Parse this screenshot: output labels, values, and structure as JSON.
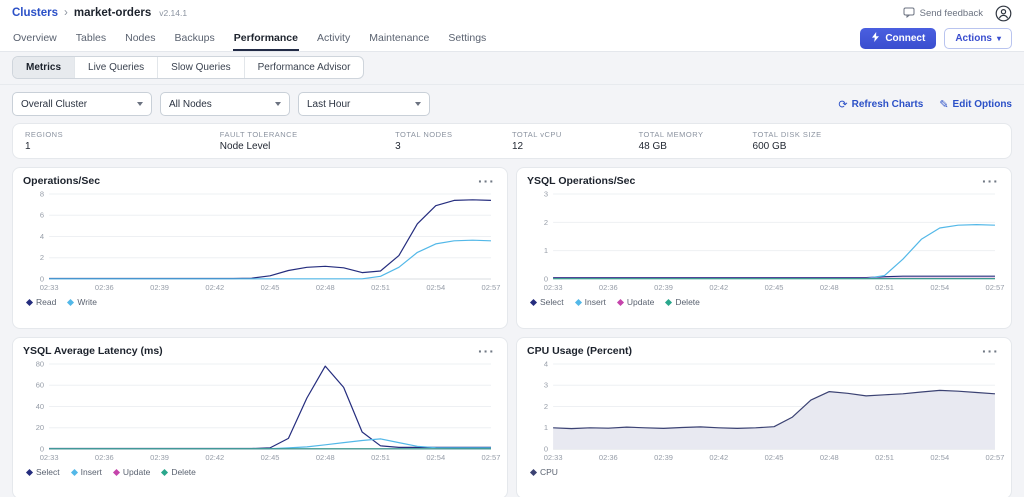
{
  "header": {
    "breadcrumb_root": "Clusters",
    "separator": "›",
    "cluster_name": "market-orders",
    "version": "v2.14.1",
    "send_feedback": "Send feedback"
  },
  "tabs": {
    "items": [
      "Overview",
      "Tables",
      "Nodes",
      "Backups",
      "Performance",
      "Activity",
      "Maintenance",
      "Settings"
    ],
    "active": "Performance",
    "connect_label": "Connect",
    "actions_label": "Actions"
  },
  "subtabs": {
    "items": [
      "Metrics",
      "Live Queries",
      "Slow Queries",
      "Performance Advisor"
    ],
    "active": "Metrics"
  },
  "filters": {
    "cluster_select": "Overall Cluster",
    "nodes_select": "All Nodes",
    "time_select": "Last Hour",
    "refresh_label": "Refresh Charts",
    "edit_label": "Edit Options"
  },
  "stats": {
    "items": [
      {
        "label": "REGIONS",
        "value": "1"
      },
      {
        "label": "FAULT TOLERANCE",
        "value": "Node Level"
      },
      {
        "label": "TOTAL NODES",
        "value": "3"
      },
      {
        "label": "TOTAL vCPU",
        "value": "12"
      },
      {
        "label": "TOTAL MEMORY",
        "value": "48 GB"
      },
      {
        "label": "TOTAL DISK SIZE",
        "value": "600 GB"
      }
    ]
  },
  "icons": {
    "refresh_glyph": "⟳",
    "edit_glyph": "✎",
    "caret_glyph": "▾"
  },
  "colors": {
    "accent_blue": "#2b50c7",
    "navy_series": "#252d7e",
    "light_blue_series": "#53b8e8",
    "magenta_series": "#c544ab",
    "teal_series": "#2aa78c",
    "cpu_line": "#3b4273",
    "cpu_fill": "#e8e9f1"
  },
  "chart_data": [
    {
      "type": "line",
      "title": "Operations/Sec",
      "ylim": [
        0,
        8
      ],
      "yticks": [
        0,
        2,
        4,
        6,
        8
      ],
      "x_labels": [
        "02:33",
        "02:36",
        "02:39",
        "02:42",
        "02:45",
        "02:48",
        "02:51",
        "02:54",
        "02:57"
      ],
      "x_label_step": 3,
      "series": [
        {
          "name": "Read",
          "color": "#252d7e",
          "values": [
            0.05,
            0.05,
            0.05,
            0.05,
            0.05,
            0.05,
            0.05,
            0.05,
            0.05,
            0.05,
            0.05,
            0.08,
            0.3,
            0.8,
            1.1,
            1.2,
            1.05,
            0.6,
            0.75,
            2.2,
            5.2,
            6.9,
            7.4,
            7.45,
            7.4
          ]
        },
        {
          "name": "Write",
          "color": "#53b8e8",
          "values": [
            0.02,
            0.02,
            0.02,
            0.02,
            0.02,
            0.02,
            0.02,
            0.02,
            0.02,
            0.02,
            0.02,
            0.02,
            0.02,
            0.02,
            0.02,
            0.02,
            0.02,
            0.02,
            0.25,
            1.1,
            2.5,
            3.3,
            3.6,
            3.65,
            3.6
          ]
        }
      ]
    },
    {
      "type": "line",
      "title": "YSQL Operations/Sec",
      "ylim": [
        0,
        3
      ],
      "yticks": [
        0,
        1,
        2,
        3
      ],
      "x_labels": [
        "02:33",
        "02:36",
        "02:39",
        "02:42",
        "02:45",
        "02:48",
        "02:51",
        "02:54",
        "02:57"
      ],
      "x_label_step": 3,
      "series": [
        {
          "name": "Select",
          "color": "#252d7e",
          "values": [
            0.05,
            0.05,
            0.05,
            0.05,
            0.05,
            0.05,
            0.05,
            0.05,
            0.05,
            0.05,
            0.05,
            0.05,
            0.05,
            0.05,
            0.05,
            0.05,
            0.05,
            0.05,
            0.08,
            0.1,
            0.1,
            0.1,
            0.1,
            0.1,
            0.1
          ]
        },
        {
          "name": "Insert",
          "color": "#53b8e8",
          "values": [
            0.02,
            0.02,
            0.02,
            0.02,
            0.02,
            0.02,
            0.02,
            0.02,
            0.02,
            0.02,
            0.02,
            0.02,
            0.02,
            0.02,
            0.02,
            0.02,
            0.02,
            0.02,
            0.12,
            0.7,
            1.4,
            1.8,
            1.9,
            1.92,
            1.9
          ]
        },
        {
          "name": "Update",
          "color": "#c544ab",
          "values": [
            0.02,
            0.02,
            0.02,
            0.02,
            0.02,
            0.02,
            0.02,
            0.02,
            0.02,
            0.02,
            0.02,
            0.02,
            0.02,
            0.02,
            0.02,
            0.02,
            0.02,
            0.02,
            0.02,
            0.02,
            0.02,
            0.02,
            0.02,
            0.02,
            0.02
          ]
        },
        {
          "name": "Delete",
          "color": "#2aa78c",
          "values": [
            0.01,
            0.01,
            0.01,
            0.01,
            0.01,
            0.01,
            0.01,
            0.01,
            0.01,
            0.01,
            0.01,
            0.01,
            0.01,
            0.01,
            0.01,
            0.01,
            0.01,
            0.01,
            0.01,
            0.01,
            0.01,
            0.01,
            0.01,
            0.01,
            0.01
          ]
        }
      ]
    },
    {
      "type": "line",
      "title": "YSQL Average Latency (ms)",
      "ylim": [
        0,
        80
      ],
      "yticks": [
        0,
        20,
        40,
        60,
        80
      ],
      "x_labels": [
        "02:33",
        "02:36",
        "02:39",
        "02:42",
        "02:45",
        "02:48",
        "02:51",
        "02:54",
        "02:57"
      ],
      "x_label_step": 3,
      "series": [
        {
          "name": "Select",
          "color": "#252d7e",
          "values": [
            0.5,
            0.5,
            0.5,
            0.5,
            0.5,
            0.5,
            0.5,
            0.5,
            0.5,
            0.5,
            0.5,
            0.5,
            1,
            10,
            48,
            78,
            58,
            16,
            3,
            1.5,
            1.5,
            1.5,
            1.5,
            1.5,
            1.5
          ]
        },
        {
          "name": "Insert",
          "color": "#53b8e8",
          "values": [
            0.3,
            0.3,
            0.3,
            0.3,
            0.3,
            0.3,
            0.3,
            0.3,
            0.3,
            0.3,
            0.3,
            0.3,
            0.3,
            1,
            2,
            4,
            6,
            8,
            9.5,
            6,
            2.5,
            1.2,
            1,
            1,
            1
          ]
        },
        {
          "name": "Update",
          "color": "#c544ab",
          "values": [
            0.2,
            0.2,
            0.2,
            0.2,
            0.2,
            0.2,
            0.2,
            0.2,
            0.2,
            0.2,
            0.2,
            0.2,
            0.2,
            0.2,
            0.2,
            0.2,
            0.2,
            0.2,
            0.2,
            0.2,
            0.2,
            0.2,
            0.2,
            0.2,
            0.2
          ]
        },
        {
          "name": "Delete",
          "color": "#2aa78c",
          "values": [
            0.15,
            0.15,
            0.15,
            0.15,
            0.15,
            0.15,
            0.15,
            0.15,
            0.15,
            0.15,
            0.15,
            0.15,
            0.15,
            0.15,
            0.15,
            0.15,
            0.15,
            0.15,
            0.15,
            0.15,
            0.15,
            0.15,
            0.15,
            0.15,
            0.15
          ]
        }
      ]
    },
    {
      "type": "area",
      "title": "CPU Usage (Percent)",
      "ylim": [
        0,
        4
      ],
      "yticks": [
        0,
        1,
        2,
        3,
        4
      ],
      "x_labels": [
        "02:33",
        "02:36",
        "02:39",
        "02:42",
        "02:45",
        "02:48",
        "02:51",
        "02:54",
        "02:57"
      ],
      "x_label_step": 3,
      "series": [
        {
          "name": "CPU",
          "color": "#3b4273",
          "fill": "#e8e9f1",
          "values": [
            1.0,
            0.96,
            1.0,
            0.98,
            1.03,
            1.0,
            0.97,
            1.01,
            1.04,
            1.0,
            0.97,
            1.0,
            1.05,
            1.5,
            2.3,
            2.7,
            2.62,
            2.5,
            2.55,
            2.6,
            2.68,
            2.76,
            2.72,
            2.66,
            2.6
          ]
        }
      ]
    }
  ]
}
